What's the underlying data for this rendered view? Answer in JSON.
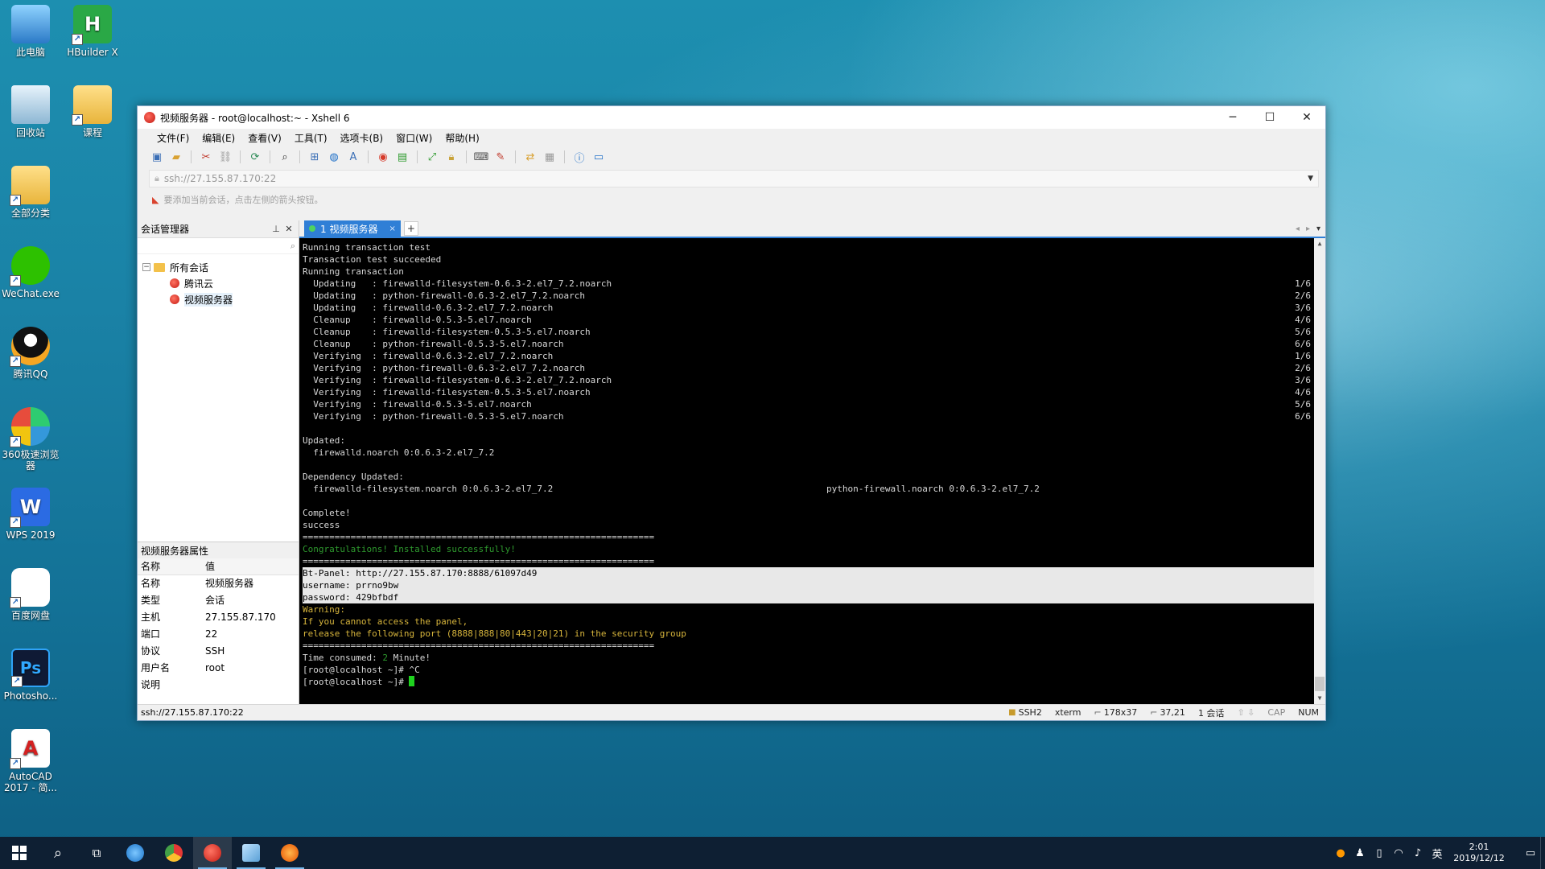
{
  "desktop": {
    "icons": [
      {
        "label": "此电脑",
        "icon": "computer-icon"
      },
      {
        "label": "HBuilder X",
        "icon": "hbuilder-icon"
      },
      {
        "label": "回收站",
        "icon": "recycle-bin-icon"
      },
      {
        "label": "课程",
        "icon": "folder-icon"
      },
      {
        "label": "全部分类",
        "icon": "folder-icon"
      },
      {
        "label": "WeChat.exe",
        "icon": "wechat-icon"
      },
      {
        "label": "腾讯QQ",
        "icon": "qq-icon"
      },
      {
        "label": "360极速浏览器",
        "icon": "browser-360-icon"
      },
      {
        "label": "WPS 2019",
        "icon": "wps-icon"
      },
      {
        "label": "百度网盘",
        "icon": "baidu-netdisk-icon"
      },
      {
        "label": "Photosho...",
        "icon": "photoshop-icon"
      },
      {
        "label": "AutoCAD 2017 - 简...",
        "icon": "autocad-icon"
      }
    ],
    "glyphs": {
      "hbuilder": "H",
      "wps": "W",
      "photoshop": "Ps",
      "autocad": "A"
    }
  },
  "window": {
    "title": "视频服务器 - root@localhost:~ - Xshell 6",
    "menu": [
      "文件(F)",
      "编辑(E)",
      "查看(V)",
      "工具(T)",
      "选项卡(B)",
      "窗口(W)",
      "帮助(H)"
    ],
    "address": "ssh://27.155.87.170:22",
    "hint": "要添加当前会话，点击左侧的箭头按钮。"
  },
  "session_manager": {
    "title": "会话管理器",
    "root": "所有会话",
    "sessions": [
      "腾讯云",
      "视频服务器"
    ]
  },
  "properties": {
    "title": "视频服务器属性",
    "header": {
      "name": "名称",
      "value": "值"
    },
    "rows": [
      {
        "k": "名称",
        "v": "视频服务器"
      },
      {
        "k": "类型",
        "v": "会话"
      },
      {
        "k": "主机",
        "v": "27.155.87.170"
      },
      {
        "k": "端口",
        "v": "22"
      },
      {
        "k": "协议",
        "v": "SSH"
      },
      {
        "k": "用户名",
        "v": "root"
      },
      {
        "k": "说明",
        "v": ""
      }
    ]
  },
  "tab": {
    "label": "1 视频服务器",
    "close": "×",
    "add": "+"
  },
  "terminal": {
    "lines": [
      {
        "t": "Running transaction test"
      },
      {
        "t": "Transaction test succeeded"
      },
      {
        "t": "Running transaction"
      },
      {
        "t": "  Updating   : firewalld-filesystem-0.6.3-2.el7_7.2.noarch",
        "r": "1/6"
      },
      {
        "t": "  Updating   : python-firewall-0.6.3-2.el7_7.2.noarch",
        "r": "2/6"
      },
      {
        "t": "  Updating   : firewalld-0.6.3-2.el7_7.2.noarch",
        "r": "3/6"
      },
      {
        "t": "  Cleanup    : firewalld-0.5.3-5.el7.noarch",
        "r": "4/6"
      },
      {
        "t": "  Cleanup    : firewalld-filesystem-0.5.3-5.el7.noarch",
        "r": "5/6"
      },
      {
        "t": "  Cleanup    : python-firewall-0.5.3-5.el7.noarch",
        "r": "6/6"
      },
      {
        "t": "  Verifying  : firewalld-0.6.3-2.el7_7.2.noarch",
        "r": "1/6"
      },
      {
        "t": "  Verifying  : python-firewall-0.6.3-2.el7_7.2.noarch",
        "r": "2/6"
      },
      {
        "t": "  Verifying  : firewalld-filesystem-0.6.3-2.el7_7.2.noarch",
        "r": "3/6"
      },
      {
        "t": "  Verifying  : firewalld-filesystem-0.5.3-5.el7.noarch",
        "r": "4/6"
      },
      {
        "t": "  Verifying  : firewalld-0.5.3-5.el7.noarch",
        "r": "5/6"
      },
      {
        "t": "  Verifying  : python-firewall-0.5.3-5.el7.noarch",
        "r": "6/6"
      },
      {
        "t": ""
      },
      {
        "t": "Updated:"
      },
      {
        "t": "  firewalld.noarch 0:0.6.3-2.el7_7.2"
      },
      {
        "t": ""
      },
      {
        "t": "Dependency Updated:"
      },
      {
        "t": "  firewalld-filesystem.noarch 0:0.6.3-2.el7_7.2",
        "m": "python-firewall.noarch 0:0.6.3-2.el7_7.2"
      },
      {
        "t": ""
      },
      {
        "t": "Complete!"
      },
      {
        "t": "success"
      },
      {
        "t": "=================================================================="
      },
      {
        "t": "Congratulations! Installed successfully!",
        "c": "green"
      },
      {
        "t": "=================================================================="
      },
      {
        "t": "Bt-Panel: http://27.155.87.170:8888/61097d49",
        "c": "hl"
      },
      {
        "t": "username: prrno9bw",
        "c": "hl"
      },
      {
        "t": "password: 429bfbdf",
        "c": "hl"
      },
      {
        "t": "Warning:",
        "c": "yellow"
      },
      {
        "t": "If you cannot access the panel,",
        "c": "yellow"
      },
      {
        "t": "release the following port (8888|888|80|443|20|21) in the security group",
        "c": "yellow"
      },
      {
        "t": "=================================================================="
      },
      {
        "t": "Time consumed: ",
        "g": "2",
        "e": " Minute!"
      },
      {
        "t": "[root@localhost ~]# ^C"
      },
      {
        "t": "[root@localhost ~]# ",
        "cursor": true
      }
    ]
  },
  "statusbar": {
    "address": "ssh://27.155.87.170:22",
    "protocol": "SSH2",
    "term": "xterm",
    "size": "178x37",
    "pos": "37,21",
    "sessions": "1 会话",
    "caps": "CAP",
    "num": "NUM"
  },
  "taskbar": {
    "ime": "英",
    "time": "2:01",
    "date": "2019/12/12"
  }
}
